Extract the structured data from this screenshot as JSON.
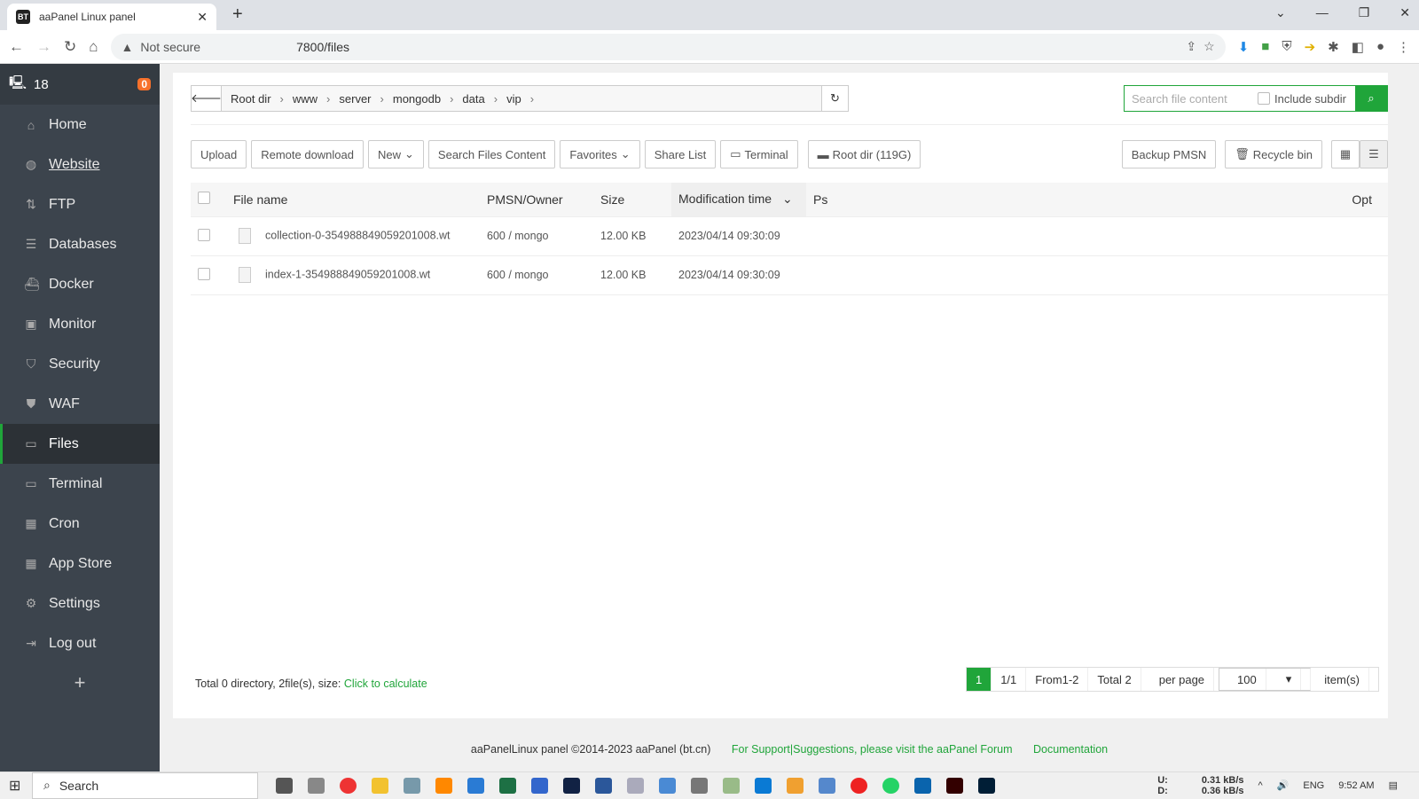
{
  "browser": {
    "tab_title": "aaPanel Linux panel",
    "tab_favicon": "BT",
    "security": "Not secure",
    "url": "7800/files"
  },
  "sidebar": {
    "server_label": "18",
    "badge": "0",
    "items": [
      {
        "label": "Home",
        "icon": "home-icon"
      },
      {
        "label": "Website",
        "icon": "globe-icon"
      },
      {
        "label": "FTP",
        "icon": "ftp-icon"
      },
      {
        "label": "Databases",
        "icon": "database-icon"
      },
      {
        "label": "Docker",
        "icon": "docker-icon"
      },
      {
        "label": "Monitor",
        "icon": "monitor-icon"
      },
      {
        "label": "Security",
        "icon": "shield-icon"
      },
      {
        "label": "WAF",
        "icon": "waf-icon"
      },
      {
        "label": "Files",
        "icon": "folder-icon"
      },
      {
        "label": "Terminal",
        "icon": "terminal-icon"
      },
      {
        "label": "Cron",
        "icon": "calendar-icon"
      },
      {
        "label": "App Store",
        "icon": "apps-icon"
      },
      {
        "label": "Settings",
        "icon": "gear-icon"
      },
      {
        "label": "Log out",
        "icon": "logout-icon"
      }
    ],
    "add": "+"
  },
  "breadcrumb": [
    "Root dir",
    "www",
    "server",
    "mongodb",
    "data",
    "vip"
  ],
  "search": {
    "placeholder": "Search file content",
    "include_subdir": "Include subdir"
  },
  "toolbar": {
    "upload": "Upload",
    "remote": "Remote download",
    "new": "New",
    "search_content": "Search Files Content",
    "favorites": "Favorites",
    "share": "Share List",
    "terminal": "Terminal",
    "rootdir": "Root dir (119G)",
    "backup": "Backup PMSN",
    "recycle": "Recycle bin"
  },
  "table": {
    "headers": {
      "name": "File name",
      "perm": "PMSN/Owner",
      "size": "Size",
      "mtime": "Modification time",
      "ps": "Ps",
      "opt": "Opt"
    },
    "rows": [
      {
        "name": "collection-0-354988849059201008.wt",
        "perm": "600 / mongo",
        "size": "12.00 KB",
        "mtime": "2023/04/14 09:30:09"
      },
      {
        "name": "index-1-354988849059201008.wt",
        "perm": "600 / mongo",
        "size": "12.00 KB",
        "mtime": "2023/04/14 09:30:09"
      }
    ]
  },
  "footer": {
    "summary": "Total 0 directory, 2file(s), size:",
    "calc": "Click to calculate"
  },
  "pager": {
    "current": "1",
    "pages": "1/1",
    "range": "From1-2",
    "total": "Total 2",
    "per_page": "per page",
    "per_value": "100",
    "items": "item(s)"
  },
  "copyright": {
    "text": "aaPanelLinux panel ©2014-2023 aaPanel (bt.cn)",
    "support": "For Support|Suggestions, please visit the aaPanel Forum",
    "docs": "Documentation"
  },
  "taskbar": {
    "search": "Search",
    "up": "U:",
    "down": "D:",
    "up_rate": "0.31 kB/s",
    "down_rate": "0.36 kB/s",
    "lang": "ENG",
    "time": "9:52 AM"
  }
}
